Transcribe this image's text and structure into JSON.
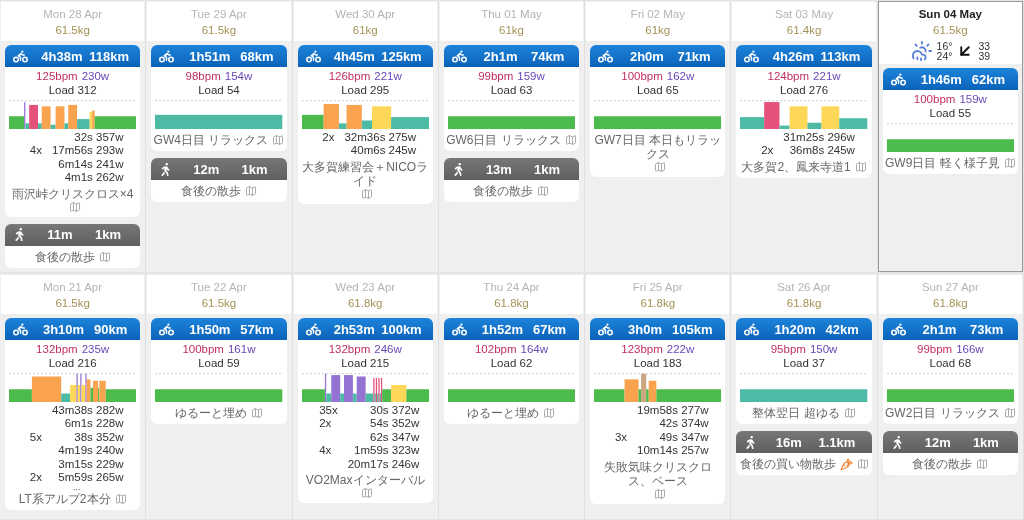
{
  "weeks": [
    {
      "days": [
        {
          "date": "Mon 28 Apr",
          "weight": "61.5kg",
          "today": false,
          "activities": [
            {
              "kind": "ride",
              "duration": "4h38m",
              "distance": "118km",
              "hr": "125bpm",
              "power": "230w",
              "load": "Load 312",
              "intervals": [
                {
                  "value": "32s 357w"
                },
                {
                  "reps": "4x",
                  "value": "17m56s 293w"
                },
                {
                  "value": "6m14s 241w"
                },
                {
                  "value": "4m1s 262w"
                }
              ],
              "name": "雨沢峠クリスクロス×4"
            },
            {
              "kind": "walk",
              "duration": "11m",
              "distance": "1km",
              "name": "食後の散歩"
            }
          ]
        },
        {
          "date": "Tue 29 Apr",
          "weight": "61.5kg",
          "today": false,
          "activities": [
            {
              "kind": "ride",
              "duration": "1h51m",
              "distance": "68km",
              "hr": "98bpm",
              "power": "154w",
              "load": "Load 54",
              "name": "GW4日目 リラックス"
            },
            {
              "kind": "walk",
              "duration": "12m",
              "distance": "1km",
              "name": "食後の散歩"
            }
          ]
        },
        {
          "date": "Wed 30 Apr",
          "weight": "61kg",
          "today": false,
          "activities": [
            {
              "kind": "ride",
              "duration": "4h45m",
              "distance": "125km",
              "hr": "126bpm",
              "power": "221w",
              "load": "Load 295",
              "intervals": [
                {
                  "reps": "2x",
                  "value": "32m36s 275w"
                },
                {
                  "value": "40m6s 245w"
                }
              ],
              "name": "大多賀練習会＋NICOライド"
            }
          ]
        },
        {
          "date": "Thu 01 May",
          "weight": "61kg",
          "today": false,
          "activities": [
            {
              "kind": "ride",
              "duration": "2h1m",
              "distance": "74km",
              "hr": "99bpm",
              "power": "159w",
              "load": "Load 63",
              "name": "GW6日目 リラックス"
            },
            {
              "kind": "walk",
              "duration": "13m",
              "distance": "1km",
              "name": "食後の散歩"
            }
          ]
        },
        {
          "date": "Fri 02 May",
          "weight": "61kg",
          "today": false,
          "activities": [
            {
              "kind": "ride",
              "duration": "2h0m",
              "distance": "71km",
              "hr": "100bpm",
              "power": "162w",
              "load": "Load 65",
              "name": "GW7日目 本日もリラックス"
            }
          ]
        },
        {
          "date": "Sat 03 May",
          "weight": "61.4kg",
          "today": false,
          "activities": [
            {
              "kind": "ride",
              "duration": "4h26m",
              "distance": "113km",
              "hr": "124bpm",
              "power": "221w",
              "load": "Load 276",
              "intervals": [
                {
                  "value": "31m25s 296w"
                },
                {
                  "reps": "2x",
                  "value": "36m8s 245w"
                }
              ],
              "name": "大多賀2、鳳来寺道1"
            }
          ]
        },
        {
          "date": "Sun 04 May",
          "weight": "61.5kg",
          "today": true,
          "weather": {
            "low": "16°",
            "high": "24°",
            "wind_1": "33",
            "wind_2": "39"
          },
          "activities": [
            {
              "kind": "ride",
              "duration": "1h46m",
              "distance": "62km",
              "hr": "100bpm",
              "power": "159w",
              "load": "Load 55",
              "name": "GW9日目 軽く様子見"
            }
          ]
        }
      ]
    },
    {
      "days": [
        {
          "date": "Mon 21 Apr",
          "weight": "61.5kg",
          "today": false,
          "activities": [
            {
              "kind": "ride",
              "duration": "3h10m",
              "distance": "90km",
              "hr": "132bpm",
              "power": "235w",
              "load": "Load 216",
              "intervals": [
                {
                  "value": "43m38s 282w"
                },
                {
                  "value": "6m1s 228w"
                },
                {
                  "reps": "5x",
                  "value": "38s 352w"
                },
                {
                  "value": "4m19s 240w"
                },
                {
                  "value": "3m15s 229w"
                },
                {
                  "reps": "2x",
                  "value": "5m59s 265w"
                }
              ],
              "more": "...",
              "name": "LT系アルプ2本分"
            }
          ]
        },
        {
          "date": "Tue 22 Apr",
          "weight": "61.5kg",
          "today": false,
          "activities": [
            {
              "kind": "ride",
              "duration": "1h50m",
              "distance": "57km",
              "hr": "100bpm",
              "power": "161w",
              "load": "Load 59",
              "name": "ゆるーと埋め"
            }
          ]
        },
        {
          "date": "Wed 23 Apr",
          "weight": "61.8kg",
          "today": false,
          "activities": [
            {
              "kind": "ride",
              "duration": "2h53m",
              "distance": "100km",
              "hr": "132bpm",
              "power": "246w",
              "load": "Load 215",
              "intervals": [
                {
                  "reps": "35x",
                  "value": "30s 372w"
                },
                {
                  "reps": "2x",
                  "value": "54s 352w"
                },
                {
                  "value": "62s 347w"
                },
                {
                  "reps": "4x",
                  "value": "1m59s 323w"
                },
                {
                  "value": "20m17s 246w"
                }
              ],
              "name": "VO2Maxインターバル"
            }
          ]
        },
        {
          "date": "Thu 24 Apr",
          "weight": "61.8kg",
          "today": false,
          "activities": [
            {
              "kind": "ride",
              "duration": "1h52m",
              "distance": "67km",
              "hr": "102bpm",
              "power": "164w",
              "load": "Load 62",
              "name": "ゆるーと埋め"
            }
          ]
        },
        {
          "date": "Fri 25 Apr",
          "weight": "61.8kg",
          "today": false,
          "activities": [
            {
              "kind": "ride",
              "duration": "3h0m",
              "distance": "105km",
              "hr": "123bpm",
              "power": "222w",
              "load": "Load 183",
              "intervals": [
                {
                  "value": "19m58s 277w"
                },
                {
                  "value": "42s 374w"
                },
                {
                  "reps": "3x",
                  "value": "49s 347w"
                },
                {
                  "value": "10m14s 257w"
                }
              ],
              "name": "失敗気味クリスクロス、ベース"
            }
          ]
        },
        {
          "date": "Sat 26 Apr",
          "weight": "61.8kg",
          "today": false,
          "activities": [
            {
              "kind": "ride",
              "duration": "1h20m",
              "distance": "42km",
              "hr": "95bpm",
              "power": "150w",
              "load": "Load 37",
              "name": "整体翌日 超ゆる"
            },
            {
              "kind": "walk",
              "duration": "16m",
              "distance": "1.1km",
              "name": "食後の買い物散歩",
              "carrot_icon": true
            }
          ]
        },
        {
          "date": "Sun 27 Apr",
          "weight": "61.8kg",
          "today": false,
          "activities": [
            {
              "kind": "ride",
              "duration": "2h1m",
              "distance": "73km",
              "hr": "99bpm",
              "power": "166w",
              "load": "Load 68",
              "name": "GW2日目 リラックス"
            },
            {
              "kind": "walk",
              "duration": "12m",
              "distance": "1km",
              "name": "食後の散歩"
            }
          ]
        }
      ]
    }
  ]
}
